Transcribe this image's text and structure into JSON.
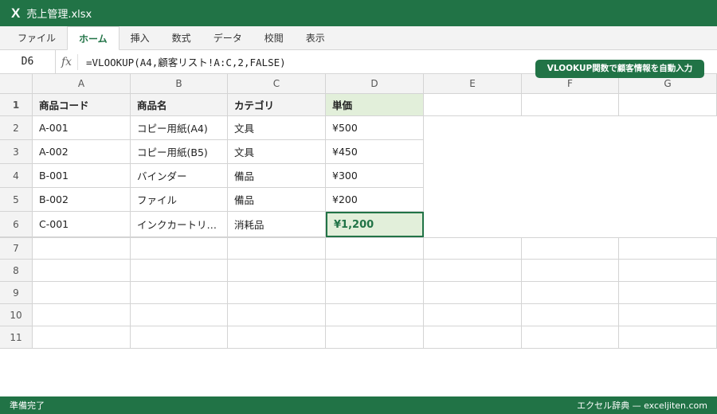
{
  "window": {
    "app_icon": "X",
    "title": "売上管理.xlsx"
  },
  "ribbon": {
    "tabs": [
      "ファイル",
      "ホーム",
      "挿入",
      "数式",
      "データ",
      "校閲",
      "表示"
    ],
    "active": "ホーム"
  },
  "formula_bar": {
    "cell_ref": "D6",
    "fx_label": "fx",
    "formula": "=VLOOKUP(A4,顧客リスト!A:C,2,FALSE)"
  },
  "badge": "VLOOKUP関数で顧客情報を自動入力",
  "columns": [
    "A",
    "B",
    "C",
    "D",
    "E",
    "F",
    "G"
  ],
  "row_numbers": [
    "1",
    "2",
    "3",
    "4",
    "5",
    "6",
    "7",
    "8",
    "9",
    "10",
    "11"
  ],
  "table": {
    "headers": [
      "商品コード",
      "商品名",
      "カテゴリ",
      "単価"
    ],
    "rows": [
      [
        "A-001",
        "コピー用紙(A4)",
        "文具",
        "¥500"
      ],
      [
        "A-002",
        "コピー用紙(B5)",
        "文具",
        "¥450"
      ],
      [
        "B-001",
        "バインダー",
        "備品",
        "¥300"
      ],
      [
        "B-002",
        "ファイル",
        "備品",
        "¥200"
      ],
      [
        "C-001",
        "インクカートリ…",
        "消耗品",
        "¥1,200"
      ]
    ]
  },
  "status": {
    "left": "準備完了",
    "right": "エクセル辞典 — exceljiten.com"
  },
  "colors": {
    "accent": "#217346",
    "highlight": "#e2efda"
  }
}
